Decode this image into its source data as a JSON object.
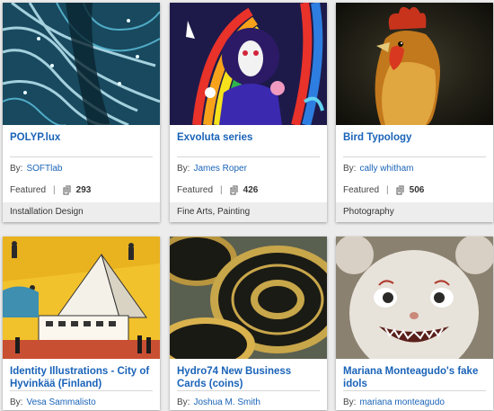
{
  "cards": [
    {
      "title": "POLYP.lux",
      "by_label": "By:",
      "owner": "SOFTlab",
      "featured": "Featured",
      "sep": "|",
      "appreciations": "293",
      "fields": "Installation Design",
      "thumb": "blue-fiber-installation"
    },
    {
      "title": "Exvoluta series",
      "by_label": "By:",
      "owner": "James Roper",
      "featured": "Featured",
      "sep": "|",
      "appreciations": "426",
      "fields": "Fine Arts, Painting",
      "thumb": "psychedelic-painting"
    },
    {
      "title": "Bird Typology",
      "by_label": "By:",
      "owner": "cally whitham",
      "featured": "Featured",
      "sep": "|",
      "appreciations": "506",
      "fields": "Photography",
      "thumb": "rooster-photo"
    },
    {
      "title": "Identity Illustrations - City of Hyvinkää (Finland)",
      "by_label": "By:",
      "owner": "Vesa Sammalisto",
      "thumb": "city-illustration"
    },
    {
      "title": "Hydro74 New Business Cards (coins)",
      "by_label": "By:",
      "owner": "Joshua M. Smith",
      "thumb": "gold-coins"
    },
    {
      "title": "Mariana Monteagudo's fake idols",
      "by_label": "By:",
      "owner": "mariana monteagudo",
      "thumb": "doll-face"
    }
  ],
  "icons": {
    "appreciation": "appreciation-icon"
  },
  "colors": {
    "link": "#1a63b8",
    "fields_bg": "#ededed",
    "page_bg": "#ececec"
  }
}
